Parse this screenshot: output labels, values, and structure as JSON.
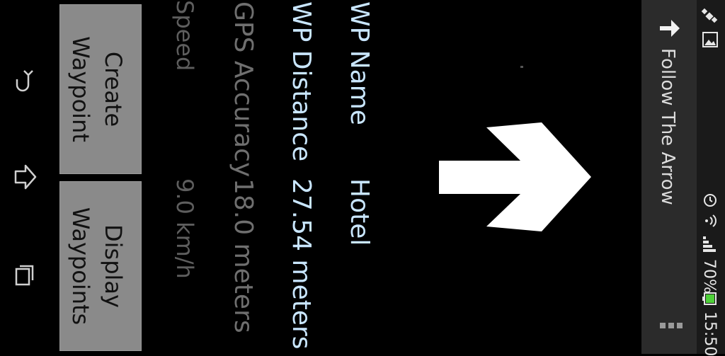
{
  "statusbar": {
    "time": "15:50",
    "battery_percent": "70%",
    "icons": [
      "satellite-icon",
      "image-icon",
      "alarm-icon",
      "wifi-icon",
      "signal-icon",
      "battery-icon"
    ]
  },
  "actionbar": {
    "title": "Follow The Arrow",
    "icons": [
      "arrow-right-icon",
      "overflow-menu-icon"
    ]
  },
  "info": {
    "wp_name_label": "WP Name",
    "wp_name_value": "Hotel",
    "wp_distance_label": "WP Distance",
    "wp_distance_value": "27.54 meters",
    "gps_accuracy_label": "GPS Accuracy",
    "gps_accuracy_value": "18.0 meters",
    "speed_label": "Speed",
    "speed_value": "9.0 km/h"
  },
  "buttons": {
    "create_line1": "Create",
    "create_line2": "Waypoint",
    "display_line1": "Display",
    "display_line2": "Waypoints"
  },
  "navbar": {
    "icons": [
      "back-icon",
      "home-icon",
      "recents-icon"
    ]
  },
  "colors": {
    "background": "#000000",
    "blue_text": "#c9e6ff",
    "grey_text": "#6f6f6f",
    "button_bg": "#8a8a8a"
  }
}
